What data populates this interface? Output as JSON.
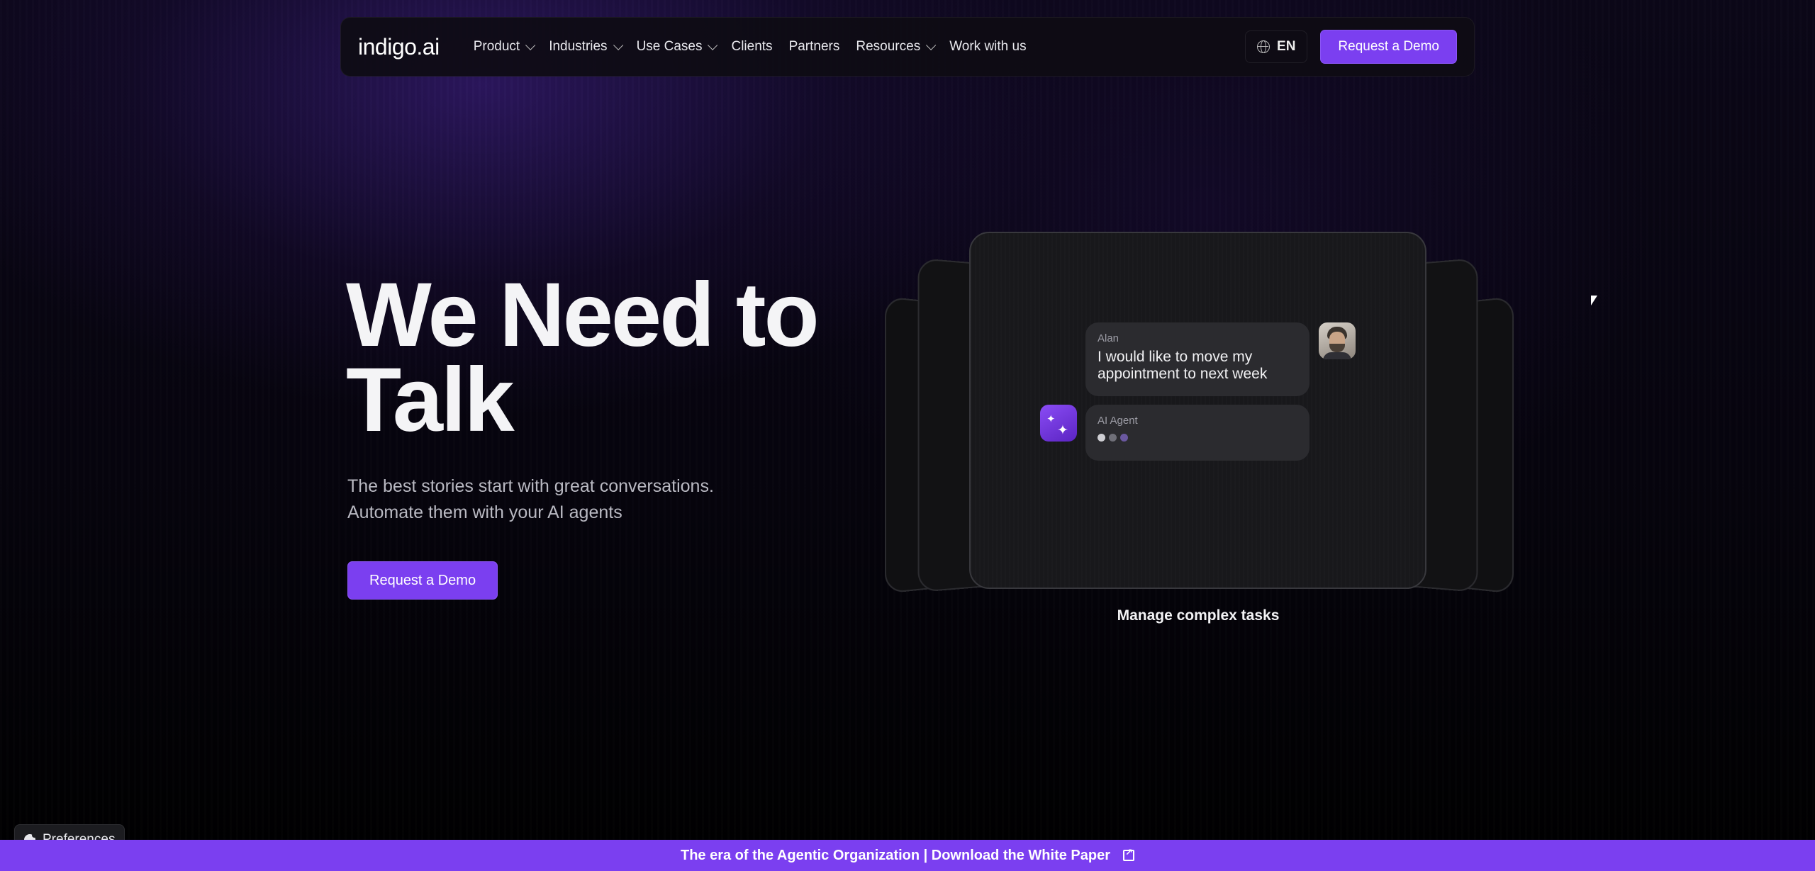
{
  "nav": {
    "logo": "indigo.ai",
    "items": [
      {
        "label": "Product",
        "dropdown": true
      },
      {
        "label": "Industries",
        "dropdown": true
      },
      {
        "label": "Use Cases",
        "dropdown": true
      },
      {
        "label": "Clients",
        "dropdown": false
      },
      {
        "label": "Partners",
        "dropdown": false
      },
      {
        "label": "Resources",
        "dropdown": true
      },
      {
        "label": "Work with us",
        "dropdown": false
      }
    ],
    "language": "EN",
    "cta_label": "Request a Demo"
  },
  "hero": {
    "title_line1": "We Need to",
    "title_line2": "Talk",
    "subtitle_line1": "The best stories start with great conversations.",
    "subtitle_line2": "Automate them with your AI agents",
    "cta_label": "Request a Demo"
  },
  "showcase": {
    "user_name": "Alan",
    "user_message": "I would like to move my appointment to next week",
    "agent_name": "AI Agent",
    "typing_dot_colors": [
      "#cfcfd4",
      "#6f6f78",
      "#6a58a0"
    ],
    "caption": "Manage complex tasks"
  },
  "preferences": {
    "label": "Preferences"
  },
  "banner": {
    "text": "The era of the Agentic Organization | Download the White Paper"
  },
  "colors": {
    "accent": "#7b3ff0",
    "background": "#000000",
    "card": "#18181b",
    "bubble": "#2b2b2f"
  },
  "icons": {
    "language": "globe-icon",
    "dropdown": "chevron-down-icon",
    "agent": "sparkle-icon",
    "preferences": "cookie-icon",
    "banner": "external-link-icon"
  }
}
